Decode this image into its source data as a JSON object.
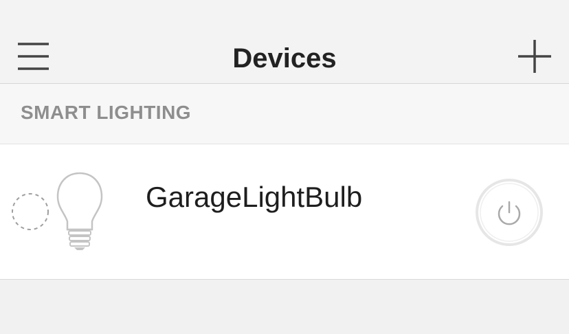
{
  "header": {
    "title": "Devices",
    "menu_icon": "hamburger-menu-icon",
    "add_icon": "plus-icon"
  },
  "section": {
    "label": "SMART LIGHTING"
  },
  "devices": [
    {
      "name": "GarageLightBulb",
      "icon": "light-bulb-icon",
      "status_icon": "dashed-circle-icon",
      "power_icon": "power-icon",
      "power_on": false
    }
  ],
  "colors": {
    "header_bg": "#f3f3f3",
    "title_text": "#222222",
    "section_label": "#8e8e8e",
    "row_bg": "#ffffff",
    "icon_gray": "#bdbdbd"
  }
}
